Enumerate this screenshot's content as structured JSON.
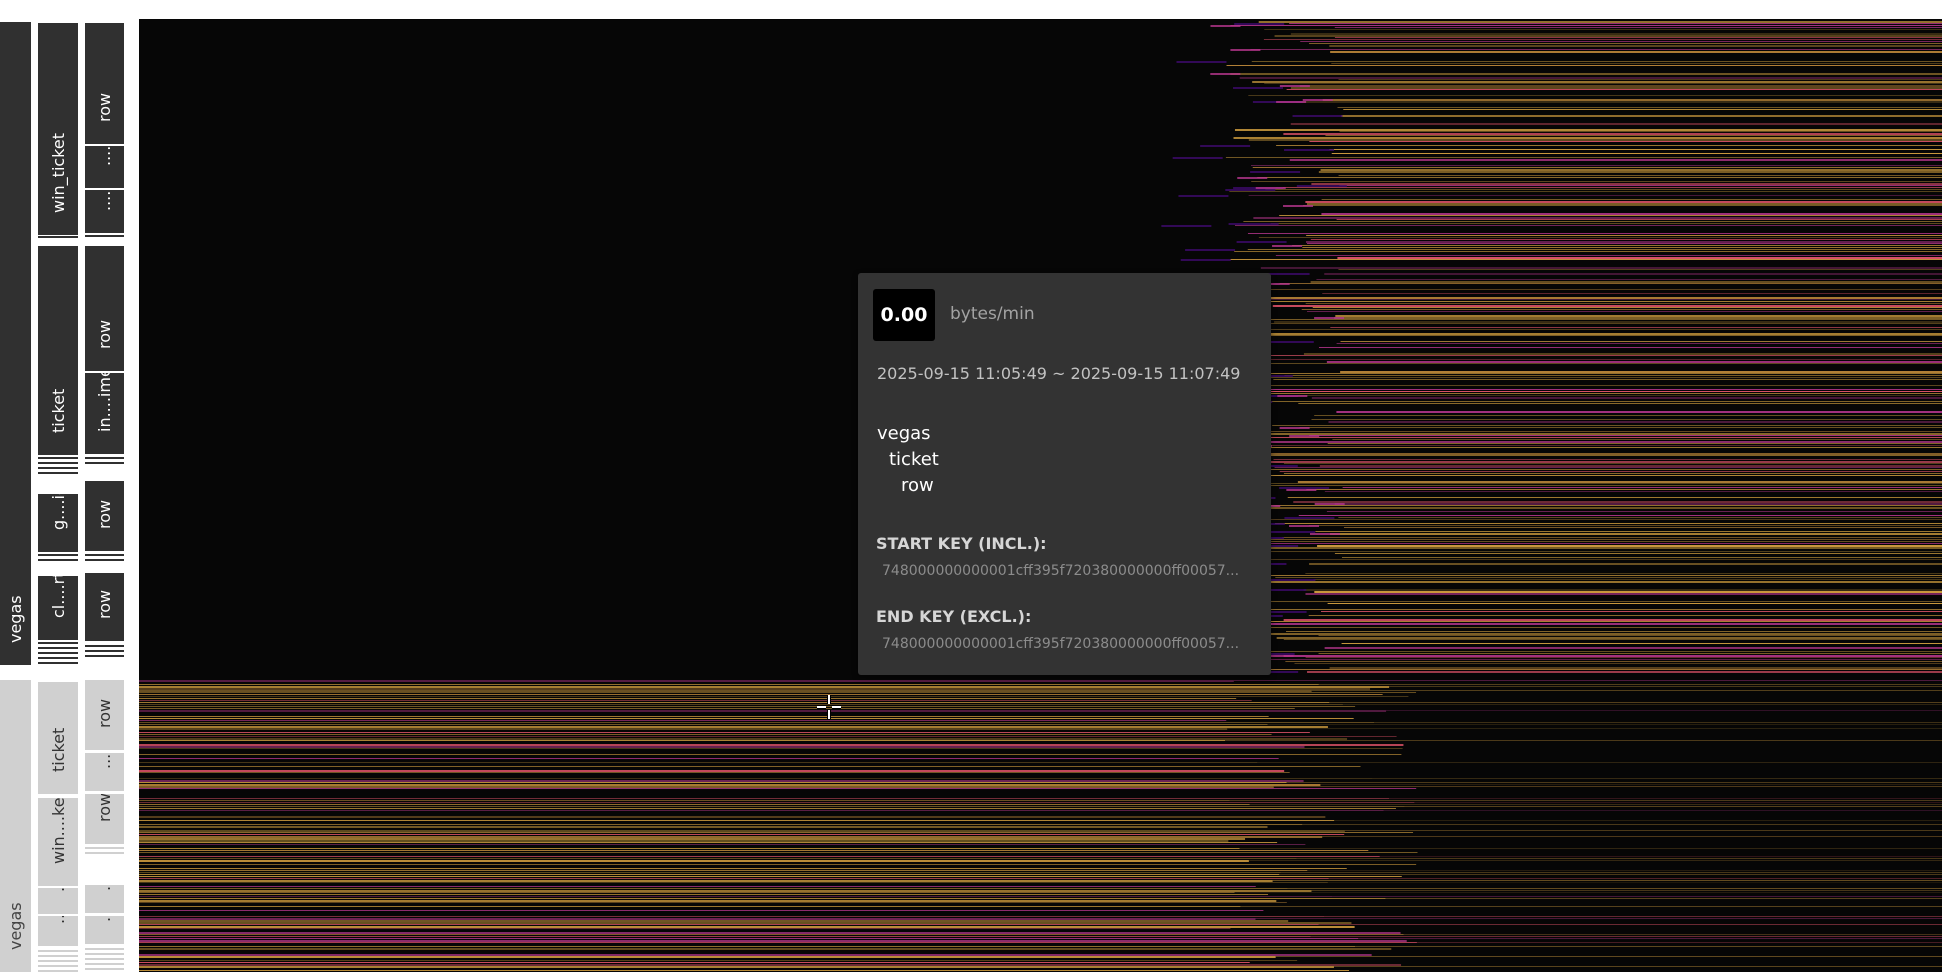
{
  "axis": {
    "level0": [
      "vegas",
      "vegas"
    ],
    "level1": [
      "win_ticket",
      "ticket",
      "g....id",
      "cl....rt",
      "ticket",
      "win....ket",
      "....",
      "...."
    ],
    "level2": [
      "row",
      "....e",
      "....e",
      "row",
      "in....ime",
      "row",
      "row",
      "row",
      "....e",
      "row",
      "....",
      "...."
    ]
  },
  "tooltip": {
    "value": "0.00",
    "unit": "bytes/min",
    "time_range": "2025-09-15 11:05:49 ~ 2025-09-15 11:07:49",
    "path": [
      "vegas",
      "ticket",
      "row"
    ],
    "start_key_label": "START KEY (INCL.):",
    "start_key": "748000000000001cff395f720380000000ff00057...",
    "end_key_label": "END KEY (EXCL.):",
    "end_key": "748000000000001cff395f720380000000ff00057..."
  },
  "colors": {
    "background": "#060606",
    "heat_low": "#3d0a6b",
    "heat_mid": "#b5368c",
    "heat_warm": "#e8566d",
    "heat_high": "#d9a441",
    "axis_dark": "#303030",
    "axis_light": "#d0d0d0",
    "tooltip_bg": "#333333"
  }
}
